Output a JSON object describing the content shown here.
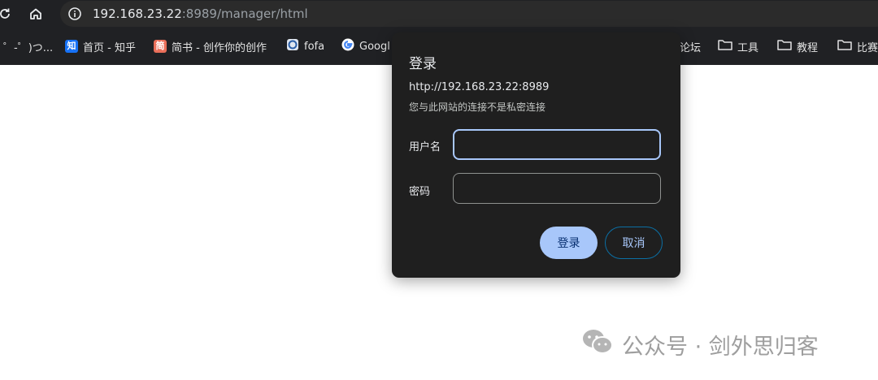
{
  "browser": {
    "url_host": "192.168.23.22",
    "url_rest": ":8989/manager/html"
  },
  "bookmarks": [
    {
      "label": "゜-゜)つ...",
      "icon": "none"
    },
    {
      "label": "首页 - 知乎",
      "icon": "zhihu-favicon",
      "badge": "知",
      "color": "#1772f6"
    },
    {
      "label": "简书 - 创作你的创作",
      "icon": "jianshu-favicon",
      "badge": "简",
      "color": "#ea6f5a"
    },
    {
      "label": "fofa",
      "icon": "fofa-favicon"
    },
    {
      "label": "Googl",
      "icon": "google-favicon"
    },
    {
      "label": "论坛",
      "icon": "none"
    },
    {
      "label": "工具",
      "icon": "folder-icon"
    },
    {
      "label": "教程",
      "icon": "folder-icon"
    },
    {
      "label": "比赛",
      "icon": "folder-icon"
    }
  ],
  "dialog": {
    "title": "登录",
    "origin": "http://192.168.23.22:8989",
    "warning": "您与此网站的连接不是私密连接",
    "username_label": "用户名",
    "username_value": "",
    "password_label": "密码",
    "password_value": "",
    "ok_label": "登录",
    "cancel_label": "取消"
  },
  "watermark": {
    "text": "公众号 · 剑外思归客",
    "icon": "wechat-icon"
  },
  "colors": {
    "chrome_bg": "#202124",
    "dialog_bg": "#1f1f1f",
    "accent": "#a8c7fa"
  }
}
